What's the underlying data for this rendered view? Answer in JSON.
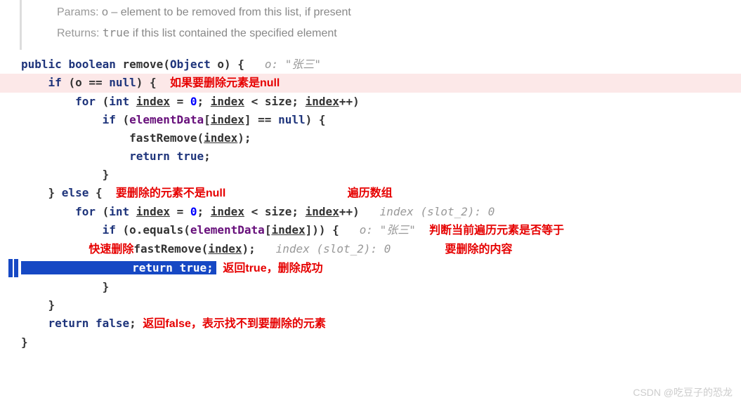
{
  "doc": {
    "params_label": "Params:",
    "params_text": "o – element to be removed from this list, if present",
    "returns_label": "Returns:",
    "returns_code": "true",
    "returns_text": " if this list contained the specified element"
  },
  "code": {
    "l1_public": "public",
    "l1_boolean": "boolean",
    "l1_method": "remove",
    "l1_type": "Object",
    "l1_param": "o",
    "l1_hint": "o: \"张三\"",
    "l2_if": "if",
    "l2_cond_open": "(o == ",
    "l2_null": "null",
    "l2_cond_close": ") {",
    "l2_comment": "如果要删除元素是null",
    "l3_for": "for",
    "l3_int": "int",
    "l3_index": "index",
    "l3_eq": " = ",
    "l3_zero": "0",
    "l3_semi": "; ",
    "l3_lt": " < size; ",
    "l3_pp": "++)",
    "l4_if": "if",
    "l4_open": " (",
    "l4_ed": "elementData",
    "l4_br_open": "[",
    "l4_br_close": "] == ",
    "l4_null": "null",
    "l4_close": ") {",
    "l5_fr": "fastRemove",
    "l5_idx": "(index);",
    "l6_return": "return",
    "l6_true": "true",
    "l7_brace": "}",
    "l8_close": "} ",
    "l8_else": "else",
    "l8_open": " {",
    "l8_comment1": "要删除的元素不是null",
    "l8_comment2": "遍历数组",
    "l9_for": "for",
    "l9_int": "int",
    "l9_index": "index",
    "l9_zero": "0",
    "l9_hint": "index (slot_2): 0",
    "l10_if": "if",
    "l10_equals": "equals",
    "l10_ed": "elementData",
    "l10_hint": "o: \"张三\"",
    "l10_comment": "判断当前遍历元素是否等于",
    "l11_comment1": "快速删除",
    "l11_fr": "fastRemove",
    "l11_hint": "index (slot_2): 0",
    "l11_comment2": "要删除的内容",
    "l12_return": "return",
    "l12_true": "true",
    "l12_comment": "返回true，删除成功",
    "l13_brace": "}",
    "l14_brace": "}",
    "l15_return": "return",
    "l15_false": "false",
    "l15_comment": "返回false，表示找不到要删除的元素",
    "l16_brace": "}"
  },
  "watermark": "CSDN @吃豆子的恐龙"
}
